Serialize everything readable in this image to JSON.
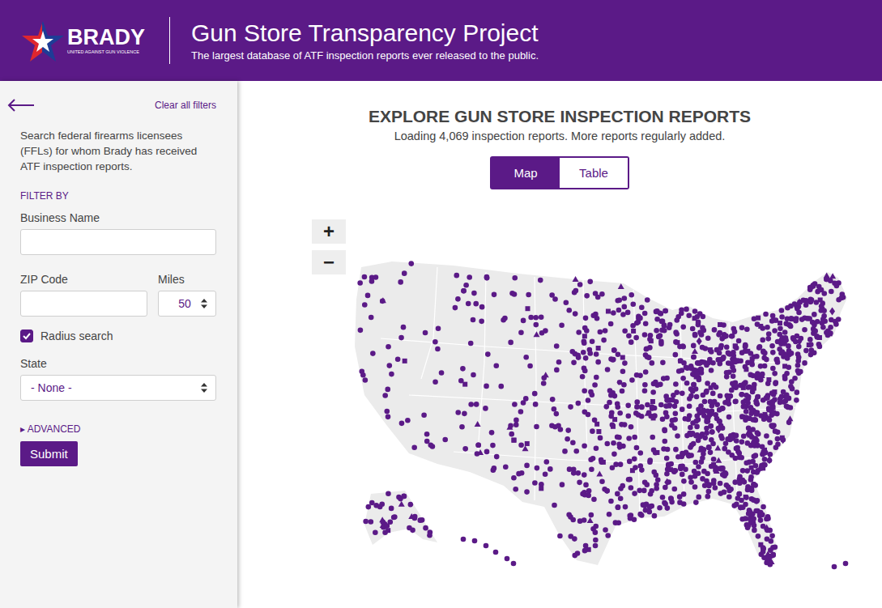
{
  "header": {
    "logo": {
      "name": "BRADY",
      "tagline": "UNITED AGAINST GUN VIOLENCE"
    },
    "title": "Gun Store Transparency Project",
    "subtitle": "The largest database of ATF inspection reports ever released to the public."
  },
  "sidebar": {
    "clear_label": "Clear all filters",
    "description": "Search federal firearms licensees (FFLs) for whom Brady has received ATF inspection reports.",
    "section_title": "FILTER BY",
    "business_name": {
      "label": "Business Name",
      "value": ""
    },
    "zip_code": {
      "label": "ZIP Code",
      "value": ""
    },
    "miles": {
      "label": "Miles",
      "value": "50"
    },
    "radius_search": {
      "label": "Radius search",
      "checked": true
    },
    "state": {
      "label": "State",
      "value": "- None -"
    },
    "advanced": {
      "label": "▸ ADVANCED"
    },
    "submit": "Submit"
  },
  "main": {
    "title": "EXPLORE GUN STORE INSPECTION REPORTS",
    "subtitle": "Loading 4,069 inspection reports. More reports regularly added.",
    "view_tabs": [
      {
        "label": "Map",
        "selected": true
      },
      {
        "label": "Table",
        "selected": false
      }
    ],
    "zoom": {
      "in": "+",
      "out": "−"
    }
  }
}
